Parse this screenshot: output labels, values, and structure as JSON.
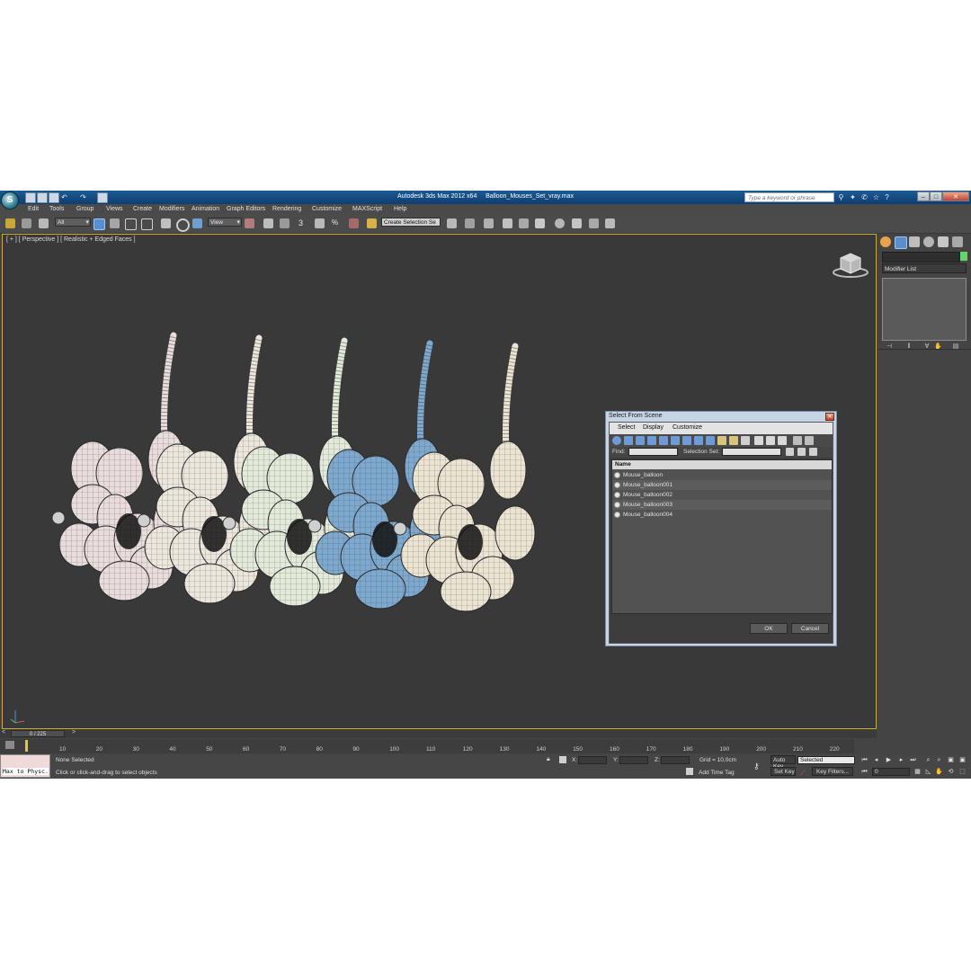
{
  "window": {
    "app_title": "Autodesk 3ds Max  2012 x64",
    "file_name": "Balloon_Mouses_Set_vray.max",
    "search_placeholder": "Type a keyword or phrase",
    "logo_letter": "S"
  },
  "menu": [
    "Edit",
    "Tools",
    "Group",
    "Views",
    "Create",
    "Modifiers",
    "Animation",
    "Graph Editors",
    "Rendering",
    "Customize",
    "MAXScript",
    "Help"
  ],
  "toolbar": {
    "selection_filter": "All",
    "reference_coord": "View",
    "named_selection": "Create Selection Se"
  },
  "viewport": {
    "label": "[ + ] [ Perspective ] [ Realistic + Edged Faces ]",
    "balloon_colors": [
      "#e9dcdc",
      "#ece6dc",
      "#e2ead9",
      "#7ea9cf",
      "#ece4d3"
    ]
  },
  "command_panel": {
    "modifier_list": "Modifier List",
    "color_swatch": "#65d46a"
  },
  "dialog": {
    "title": "Select From Scene",
    "menu": [
      "Select",
      "Display",
      "Customize"
    ],
    "find_label": "Find:",
    "selection_set_label": "Selection Set:",
    "column_header": "Name",
    "items": [
      "Mouse_balloon",
      "Mouse_balloon001",
      "Mouse_balloon002",
      "Mouse_balloon003",
      "Mouse_balloon004"
    ],
    "ok_label": "OK",
    "cancel_label": "Cancel"
  },
  "timeline": {
    "frame_indicator": "0 / 225",
    "ticks": [
      "10",
      "20",
      "30",
      "40",
      "50",
      "60",
      "70",
      "80",
      "90",
      "100",
      "110",
      "120",
      "130",
      "140",
      "150",
      "160",
      "170",
      "180",
      "190",
      "200",
      "210",
      "220"
    ]
  },
  "status": {
    "maxscript_text": "Max to Physc.",
    "selection_text": "None Selected",
    "prompt_text": "Click or click-and-drag to select objects",
    "x_label": "X:",
    "y_label": "Y:",
    "z_label": "Z:",
    "grid_text": "Grid = 10,0cm",
    "add_time_tag": "Add Time Tag",
    "auto_key": "Auto Key",
    "set_key": "Set Key",
    "key_mode": "Selected",
    "key_filters": "Key Filters...",
    "frame_value": "0"
  }
}
